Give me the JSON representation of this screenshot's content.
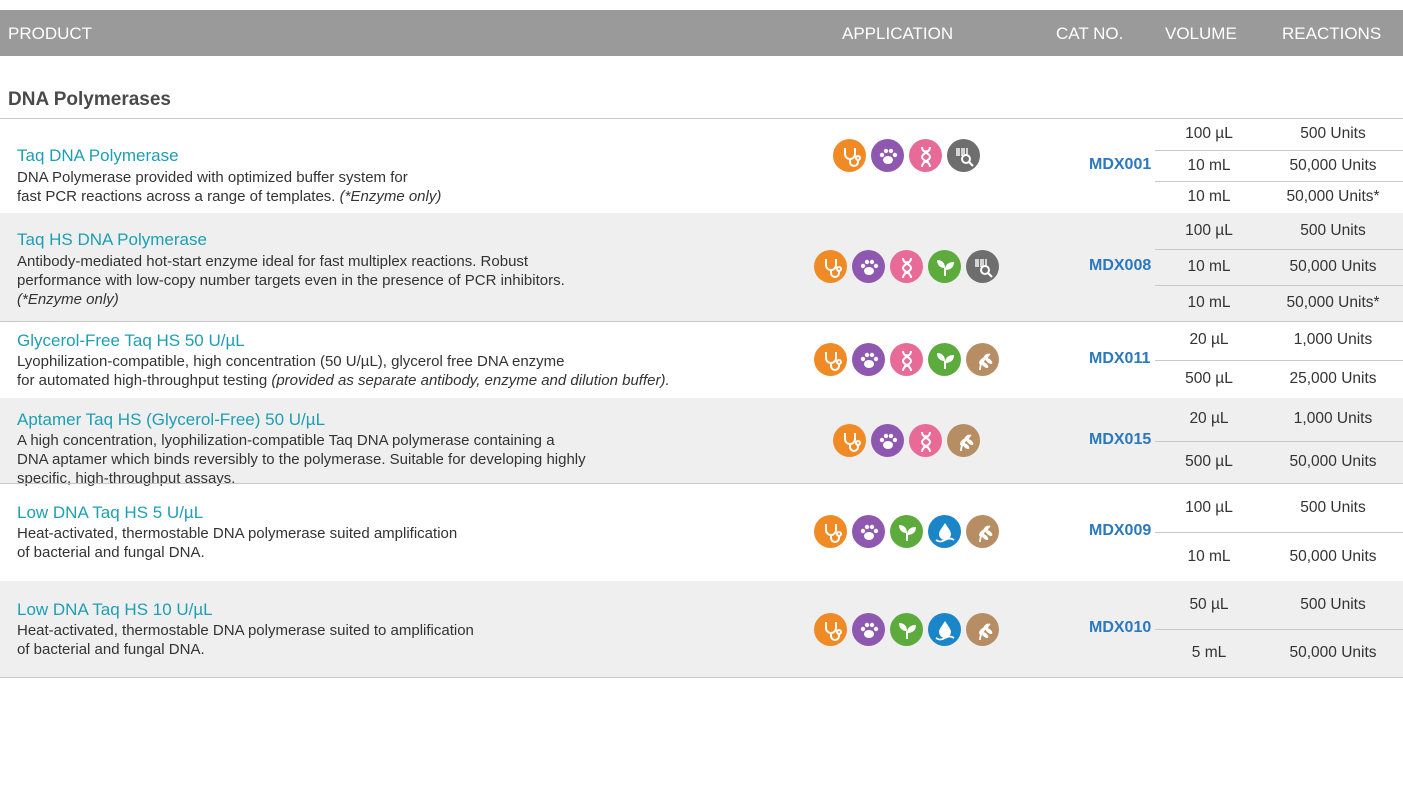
{
  "header": {
    "product": "PRODUCT",
    "application": "APPLICATION",
    "cat_no": "CAT NO.",
    "volume": "VOLUME",
    "reactions": "REACTIONS"
  },
  "section_title": "DNA Polymerases",
  "icon_colors": {
    "clinical": "#f08a24",
    "veterinary": "#8e58b0",
    "genomics": "#e86a96",
    "agriculture": "#5cab3c",
    "forensics": "#6e6e6e",
    "environment": "#1a86c8",
    "food": "#b78e63"
  },
  "products": [
    {
      "name": "Taq DNA Polymerase",
      "desc": [
        "DNA Polymerase provided with optimized buffer system for",
        "fast PCR reactions across a range of templates. "
      ],
      "desc_italic": "(*Enzyme only)",
      "icons": [
        "stethoscope-icon",
        "paw-icon",
        "dna-icon",
        "barcode-search-icon"
      ],
      "cat": "MDX001",
      "sizes": [
        {
          "volume": "100 µL",
          "reactions": "500 Units"
        },
        {
          "volume": "10 mL",
          "reactions": "50,000 Units"
        },
        {
          "volume": "10 mL",
          "reactions": "50,000 Units*"
        }
      ]
    },
    {
      "name": "Taq HS DNA Polymerase",
      "desc": [
        "Antibody-mediated hot-start enzyme ideal for fast multiplex reactions. Robust",
        "performance with low-copy number targets even in the presence of PCR inhibitors."
      ],
      "desc_italic": "(*Enzyme only)",
      "icons": [
        "stethoscope-icon",
        "paw-icon",
        "dna-icon",
        "plant-icon",
        "barcode-search-icon"
      ],
      "cat": "MDX008",
      "sizes": [
        {
          "volume": "100 µL",
          "reactions": "500 Units"
        },
        {
          "volume": "10 mL",
          "reactions": "50,000 Units"
        },
        {
          "volume": "10 mL",
          "reactions": "50,000 Units*"
        }
      ]
    },
    {
      "name": "Glycerol-Free Taq HS 50 U/µL",
      "desc": [
        "Lyophilization-compatible, high concentration (50 U/µL), glycerol free DNA enzyme",
        "for automated high-throughput testing "
      ],
      "desc_italic": "(provided as separate antibody, enzyme and dilution buffer).",
      "icons": [
        "stethoscope-icon",
        "paw-icon",
        "dna-icon",
        "plant-icon",
        "wheat-icon"
      ],
      "cat": "MDX011",
      "sizes": [
        {
          "volume": "20 µL",
          "reactions": "1,000 Units"
        },
        {
          "volume": "500 µL",
          "reactions": "25,000 Units"
        }
      ]
    },
    {
      "name": "Aptamer Taq HS (Glycerol-Free) 50 U/µL",
      "desc": [
        "A high concentration, lyophilization-compatible Taq DNA polymerase containing a",
        "DNA aptamer which binds reversibly to the polymerase. Suitable for developing highly",
        "specific, high-throughput assays."
      ],
      "desc_italic": "",
      "icons": [
        "stethoscope-icon",
        "paw-icon",
        "dna-icon",
        "wheat-icon"
      ],
      "cat": "MDX015",
      "sizes": [
        {
          "volume": "20 µL",
          "reactions": "1,000 Units"
        },
        {
          "volume": "500 µL",
          "reactions": "50,000 Units"
        }
      ]
    },
    {
      "name": "Low DNA Taq HS 5 U/µL",
      "desc": [
        "Heat-activated, thermostable DNA polymerase suited amplification",
        "of bacterial and fungal DNA."
      ],
      "desc_italic": "",
      "icons": [
        "stethoscope-icon",
        "paw-icon",
        "plant-icon",
        "water-drop-icon",
        "wheat-icon"
      ],
      "cat": "MDX009",
      "sizes": [
        {
          "volume": "100 µL",
          "reactions": "500 Units"
        },
        {
          "volume": "10 mL",
          "reactions": "50,000 Units"
        }
      ]
    },
    {
      "name": "Low DNA Taq HS 10 U/µL",
      "desc": [
        "Heat-activated, thermostable DNA polymerase suited to amplification",
        "of bacterial and fungal DNA."
      ],
      "desc_italic": "",
      "icons": [
        "stethoscope-icon",
        "paw-icon",
        "plant-icon",
        "water-drop-icon",
        "wheat-icon"
      ],
      "cat": "MDX010",
      "sizes": [
        {
          "volume": "50 µL",
          "reactions": "500 Units"
        },
        {
          "volume": "5 mL",
          "reactions": "50,000 Units"
        }
      ]
    }
  ]
}
